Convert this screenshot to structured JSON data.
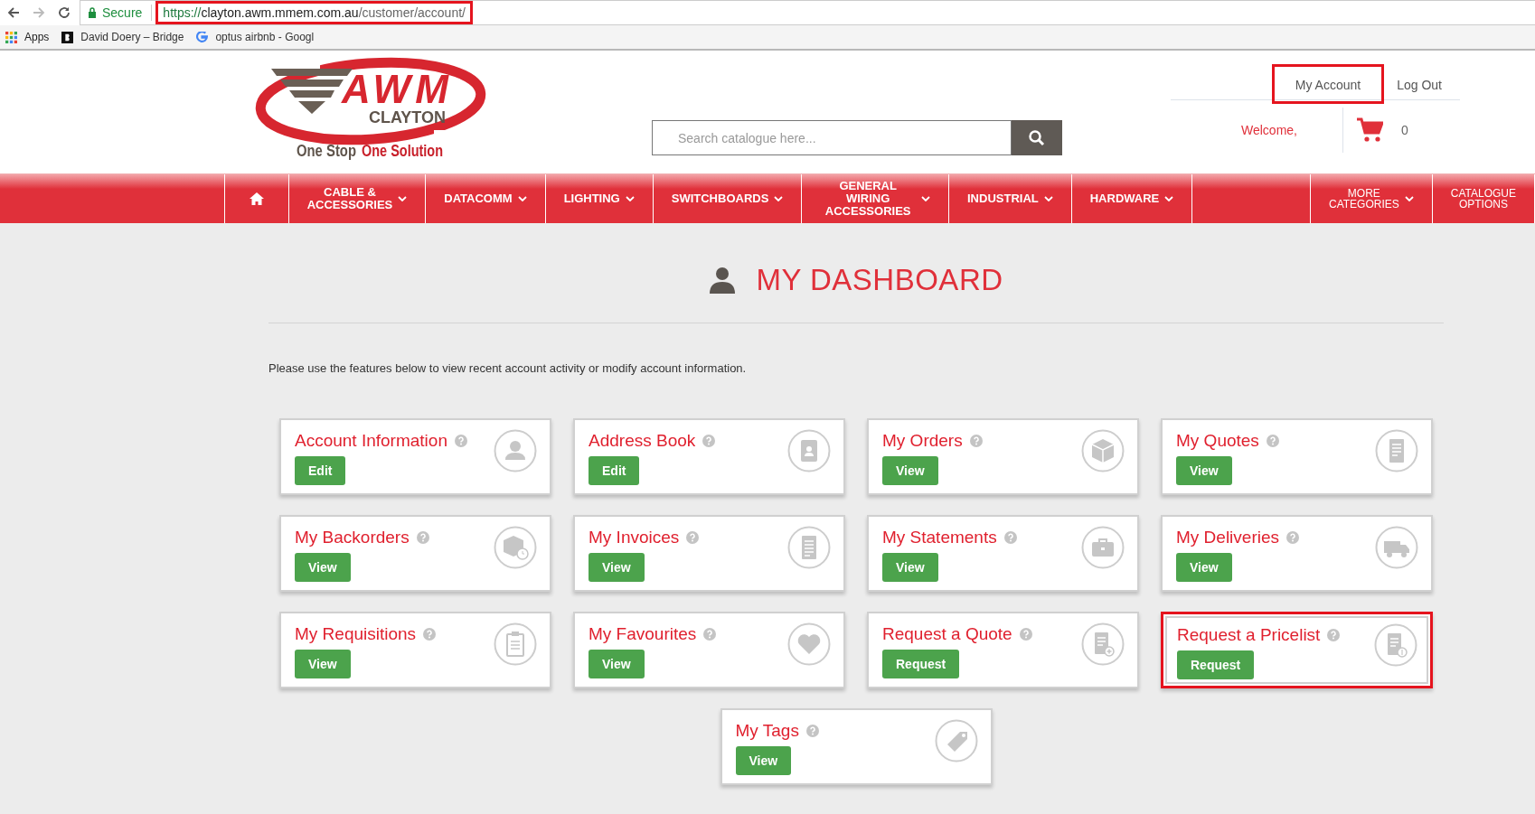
{
  "browser": {
    "secure_label": "Secure",
    "url": {
      "scheme": "https://",
      "host": "clayton.awm.mmem.com.au",
      "path": "/customer/account/",
      "highlighted": true
    },
    "bookmarks": [
      {
        "label": "Apps"
      },
      {
        "label": "David Doery – Bridge"
      },
      {
        "label": "optus airbnb - Googl"
      }
    ]
  },
  "logo": {
    "brand": "AWM",
    "branch": "CLAYTON",
    "tagline_start": "One Stop",
    "tagline_end": "One Solution"
  },
  "search": {
    "placeholder": "Search catalogue here..."
  },
  "account_links": [
    {
      "label": "My Account",
      "highlighted": true
    },
    {
      "label": "Log Out",
      "highlighted": false
    }
  ],
  "welcome": "Welcome,",
  "cart_count": "0",
  "nav": [
    {
      "kind": "home"
    },
    {
      "kind": "category",
      "lines": [
        "CABLE &",
        "ACCESSORIES"
      ],
      "menu": true
    },
    {
      "kind": "category",
      "lines": [
        "DATACOMM"
      ],
      "menu": true
    },
    {
      "kind": "category",
      "lines": [
        "LIGHTING"
      ],
      "menu": true
    },
    {
      "kind": "category",
      "lines": [
        "SWITCHBOARDS"
      ],
      "menu": true
    },
    {
      "kind": "category",
      "lines": [
        "GENERAL WIRING",
        "ACCESSORIES"
      ],
      "menu": true
    },
    {
      "kind": "category",
      "lines": [
        "INDUSTRIAL"
      ],
      "menu": true
    },
    {
      "kind": "category",
      "lines": [
        "HARDWARE"
      ],
      "menu": true
    },
    {
      "kind": "option",
      "lines": [
        "MORE",
        "CATEGORIES"
      ],
      "menu": true
    },
    {
      "kind": "option",
      "lines": [
        "CATALOGUE",
        "OPTIONS"
      ],
      "menu": false
    }
  ],
  "dashboard": {
    "title": "MY DASHBOARD",
    "intro": "Please use the features below to view recent account activity or modify account information.",
    "cards": [
      {
        "title": "Account Information",
        "button": "Edit",
        "highlighted": false
      },
      {
        "title": "Address Book",
        "button": "Edit",
        "highlighted": false
      },
      {
        "title": "My Orders",
        "button": "View",
        "highlighted": false
      },
      {
        "title": "My Quotes",
        "button": "View",
        "highlighted": false
      },
      {
        "title": "My Backorders",
        "button": "View",
        "highlighted": false
      },
      {
        "title": "My Invoices",
        "button": "View",
        "highlighted": false
      },
      {
        "title": "My Statements",
        "button": "View",
        "highlighted": false
      },
      {
        "title": "My Deliveries",
        "button": "View",
        "highlighted": false
      },
      {
        "title": "My Requisitions",
        "button": "View",
        "highlighted": false
      },
      {
        "title": "My Favourites",
        "button": "View",
        "highlighted": false
      },
      {
        "title": "Request a Quote",
        "button": "Request",
        "highlighted": false
      },
      {
        "title": "Request a Pricelist",
        "button": "Request",
        "highlighted": true
      },
      {
        "title": "My Tags",
        "button": "View",
        "highlighted": false
      }
    ]
  }
}
